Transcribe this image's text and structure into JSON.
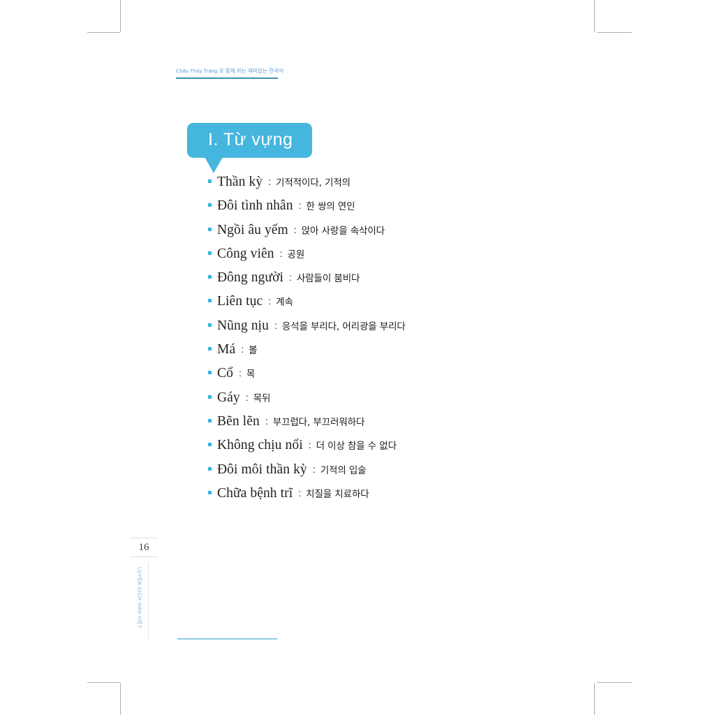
{
  "page": {
    "running_head": "Châu Thùy Trang 과 함께 하는 재미있는 한국어",
    "folio": "16",
    "side_title": "LUYỆN DỊCH HÀN VIỆT",
    "accent_color": "#45b6dd",
    "bullet_color": "#33b4e5",
    "rule_color": "#8ccbe6"
  },
  "section": {
    "banner_label": "I.  Từ vựng"
  },
  "vocabulary": {
    "separator": ":",
    "items": [
      {
        "vietnamese": "Thần kỳ",
        "korean": "기적적이다, 기적의"
      },
      {
        "vietnamese": "Đôi tình nhân",
        "korean": "한 쌍의 연인"
      },
      {
        "vietnamese": "Ngồi âu yếm",
        "korean": "앉아 사랑을 속삭이다"
      },
      {
        "vietnamese": "Công viên",
        "korean": "공원"
      },
      {
        "vietnamese": "Đông người",
        "korean": "사람들이 붐비다"
      },
      {
        "vietnamese": "Liên tục",
        "korean": "계속"
      },
      {
        "vietnamese": "Nũng nịu",
        "korean": "응석을 부리다, 어리광을 부리다"
      },
      {
        "vietnamese": "Má",
        "korean": "볼"
      },
      {
        "vietnamese": "Cổ",
        "korean": "목"
      },
      {
        "vietnamese": "Gáy",
        "korean": "목뒤"
      },
      {
        "vietnamese": "Bẽn lẽn",
        "korean": "부끄럽다, 부끄러워하다"
      },
      {
        "vietnamese": "Không chịu nổi",
        "korean": "더 이상 참을 수 없다"
      },
      {
        "vietnamese": "Đôi môi thần kỳ",
        "korean": "기적의 입술"
      },
      {
        "vietnamese": "Chữa bệnh trĩ",
        "korean": "치질을 치료하다"
      }
    ]
  }
}
